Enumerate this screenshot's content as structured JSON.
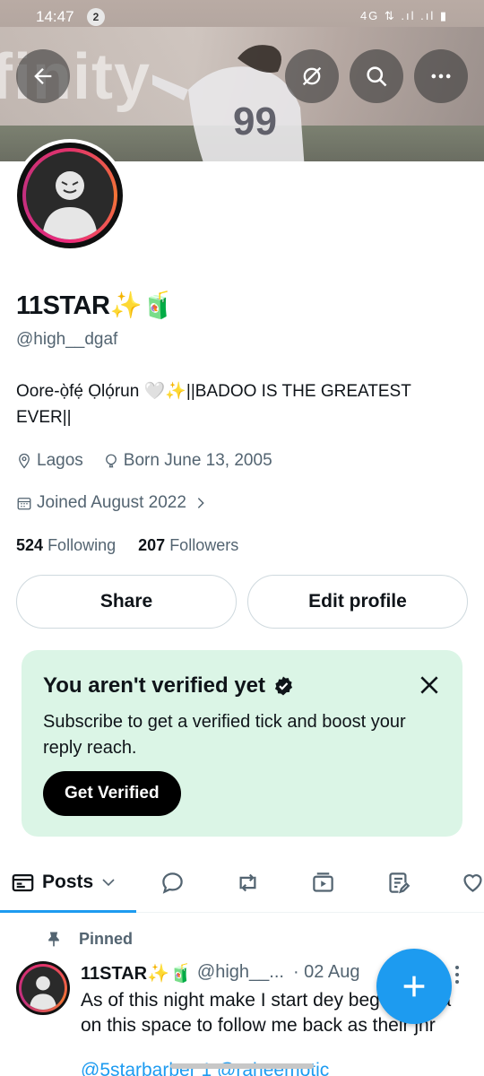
{
  "status_bar": {
    "time": "14:47",
    "notification_count": "2",
    "network": "4G ⇅ .ıl .ıl ▮"
  },
  "banner": {
    "ad_text": "finity"
  },
  "profile": {
    "name": "11STAR✨🧃",
    "handle": "@high__dgaf",
    "bio": "Oore-ọ̀fẹ́ Ọlọ́run 🤍✨||BADOO IS THE GREATEST EVER||",
    "location": "Lagos",
    "birthday": "Born June 13, 2005",
    "joined": "Joined August 2022",
    "following_count": "524",
    "following_label": "Following",
    "followers_count": "207",
    "followers_label": "Followers"
  },
  "buttons": {
    "share": "Share",
    "edit_profile": "Edit profile"
  },
  "verify_card": {
    "title": "You aren't verified yet",
    "text": "Subscribe to get a verified tick and boost your reply reach.",
    "button": "Get Verified"
  },
  "tabs": {
    "posts": "Posts"
  },
  "pinned_post": {
    "pinned_label": "Pinned",
    "author": "11STAR✨🧃",
    "handle": "@high__...",
    "date": "· 02 Aug",
    "text": "As of this night make I start dey beg two oga on this space to follow me back as their jnr",
    "mentions": "@5starbarber 1 @raheemotic"
  },
  "colors": {
    "accent": "#1d9bf0",
    "verify_bg": "#dbf5e6",
    "muted": "#536471"
  },
  "icons": [
    "back-arrow-icon",
    "hide-icon",
    "search-icon",
    "more-icon",
    "location-icon",
    "birthday-icon",
    "calendar-icon",
    "chevron-right-icon",
    "verified-badge-icon",
    "close-icon",
    "posts-icon",
    "chevron-down-icon",
    "replies-icon",
    "reposts-icon",
    "media-icon",
    "articles-icon",
    "likes-icon",
    "pin-icon",
    "compose-plus-icon"
  ]
}
